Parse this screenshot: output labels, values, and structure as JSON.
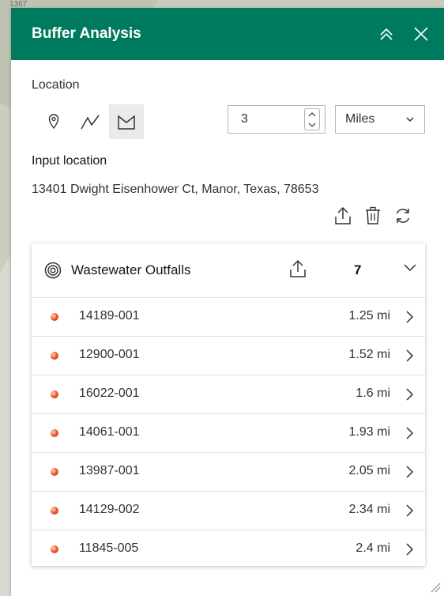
{
  "map": {
    "corner_label": "1367"
  },
  "panel": {
    "title": "Buffer Analysis",
    "location_label": "Location",
    "tools": [
      "point-tool",
      "polyline-tool",
      "polygon-tool"
    ],
    "distance": {
      "value": "3"
    },
    "units": {
      "selected": "Miles"
    },
    "input_location_label": "Input location",
    "address": "13401 Dwight Eisenhower Ct, Manor, Texas, 78653"
  },
  "results": {
    "layer_title": "Wastewater Outfalls",
    "count": "7",
    "rows": [
      {
        "id": "14189-001",
        "distance": "1.25 mi"
      },
      {
        "id": "12900-001",
        "distance": "1.52 mi"
      },
      {
        "id": "16022-001",
        "distance": "1.6 mi"
      },
      {
        "id": "14061-001",
        "distance": "1.93 mi"
      },
      {
        "id": "13987-001",
        "distance": "2.05 mi"
      },
      {
        "id": "14129-002",
        "distance": "2.34 mi"
      },
      {
        "id": "11845-005",
        "distance": "2.4 mi"
      }
    ]
  },
  "colors": {
    "header": "#007a5e",
    "point": "#e85a2c"
  }
}
